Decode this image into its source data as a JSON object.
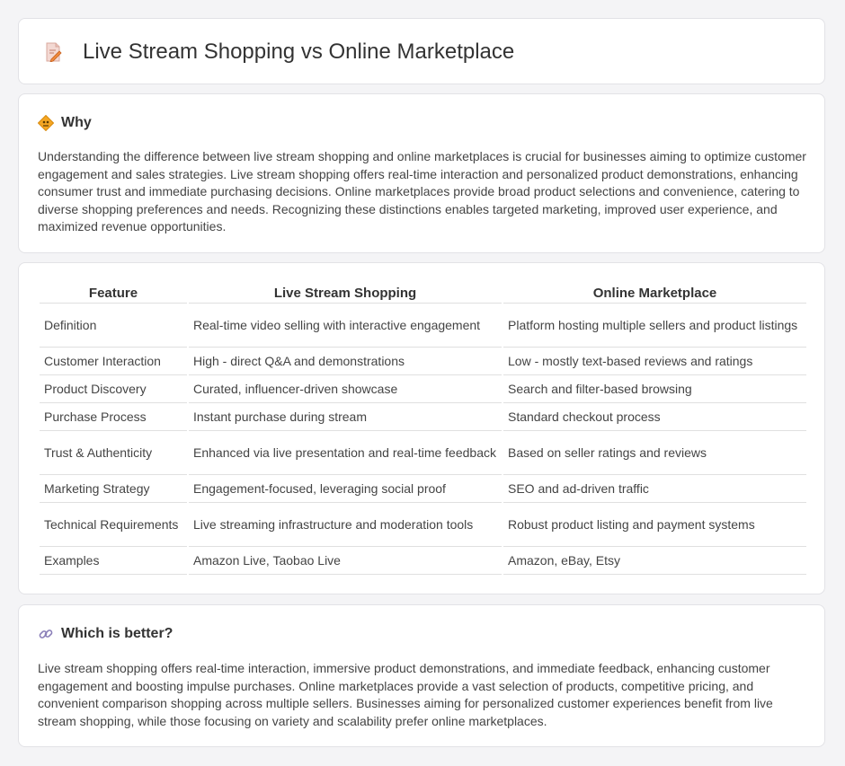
{
  "header": {
    "title": "Live Stream Shopping vs Online Marketplace",
    "icon": "document-edit-icon"
  },
  "why": {
    "heading": "Why",
    "icon": "road-sign-icon",
    "text": "Understanding the difference between live stream shopping and online marketplaces is crucial for businesses aiming to optimize customer engagement and sales strategies. Live stream shopping offers real-time interaction and personalized product demonstrations, enhancing consumer trust and immediate purchasing decisions. Online marketplaces provide broad product selections and convenience, catering to diverse shopping preferences and needs. Recognizing these distinctions enables targeted marketing, improved user experience, and maximized revenue opportunities."
  },
  "table": {
    "headers": [
      "Feature",
      "Live Stream Shopping",
      "Online Marketplace"
    ],
    "rows": [
      [
        "Definition",
        "Real-time video selling with interactive engagement",
        "Platform hosting multiple sellers and product listings"
      ],
      [
        "Customer Interaction",
        "High - direct Q&A and demonstrations",
        "Low - mostly text-based reviews and ratings"
      ],
      [
        "Product Discovery",
        "Curated, influencer-driven showcase",
        "Search and filter-based browsing"
      ],
      [
        "Purchase Process",
        "Instant purchase during stream",
        "Standard checkout process"
      ],
      [
        "Trust & Authenticity",
        "Enhanced via live presentation and real-time feedback",
        "Based on seller ratings and reviews"
      ],
      [
        "Marketing Strategy",
        "Engagement-focused, leveraging social proof",
        "SEO and ad-driven traffic"
      ],
      [
        "Technical Requirements",
        "Live streaming infrastructure and moderation tools",
        "Robust product listing and payment systems"
      ],
      [
        "Examples",
        "Amazon Live, Taobao Live",
        "Amazon, eBay, Etsy"
      ]
    ]
  },
  "better": {
    "heading": "Which is better?",
    "icon": "link-icon",
    "text": "Live stream shopping offers real-time interaction, immersive product demonstrations, and immediate feedback, enhancing customer engagement and boosting impulse purchases. Online marketplaces provide a vast selection of products, competitive pricing, and convenient comparison shopping across multiple sellers. Businesses aiming for personalized customer experiences benefit from live stream shopping, while those focusing on variety and scalability prefer online marketplaces."
  }
}
